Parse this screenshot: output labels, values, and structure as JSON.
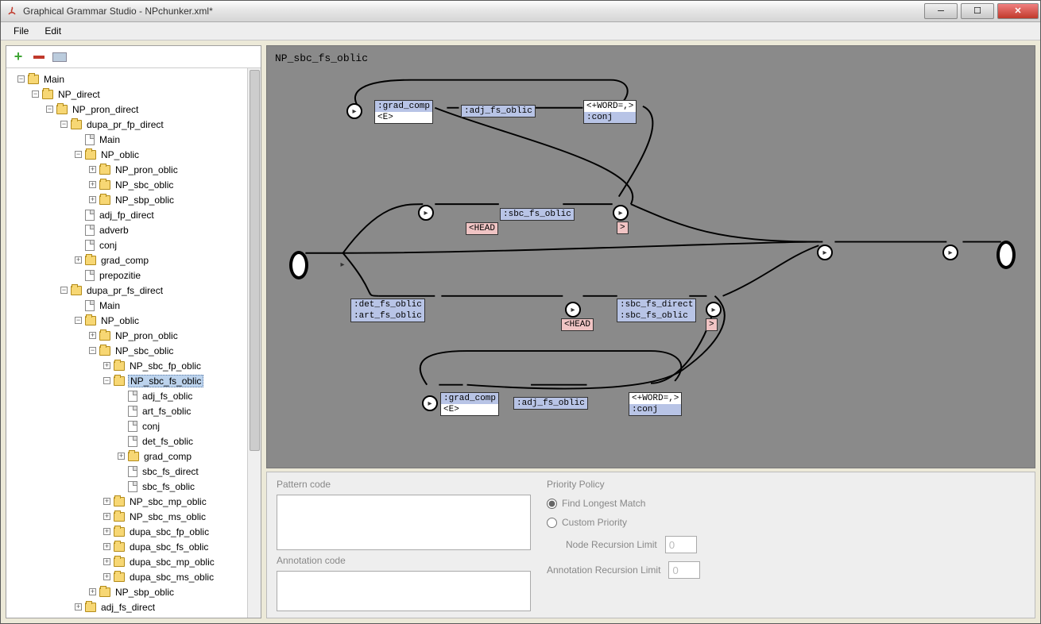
{
  "window": {
    "title": "Graphical Grammar Studio - NPchunker.xml*"
  },
  "menu": {
    "file": "File",
    "edit": "Edit"
  },
  "canvas": {
    "title": "NP_sbc_fs_oblic"
  },
  "tree": [
    {
      "d": 0,
      "t": "f",
      "x": "-",
      "l": "Main"
    },
    {
      "d": 1,
      "t": "f",
      "x": "-",
      "l": "NP_direct"
    },
    {
      "d": 2,
      "t": "f",
      "x": "-",
      "l": "NP_pron_direct"
    },
    {
      "d": 3,
      "t": "f",
      "x": "-",
      "l": "dupa_pr_fp_direct"
    },
    {
      "d": 4,
      "t": "p",
      "x": "",
      "l": "Main"
    },
    {
      "d": 4,
      "t": "f",
      "x": "-",
      "l": "NP_oblic"
    },
    {
      "d": 5,
      "t": "f",
      "x": "+",
      "l": "NP_pron_oblic"
    },
    {
      "d": 5,
      "t": "f",
      "x": "+",
      "l": "NP_sbc_oblic"
    },
    {
      "d": 5,
      "t": "f",
      "x": "+",
      "l": "NP_sbp_oblic"
    },
    {
      "d": 4,
      "t": "p",
      "x": "",
      "l": "adj_fp_direct"
    },
    {
      "d": 4,
      "t": "p",
      "x": "",
      "l": "adverb"
    },
    {
      "d": 4,
      "t": "p",
      "x": "",
      "l": "conj"
    },
    {
      "d": 4,
      "t": "f",
      "x": "+",
      "l": "grad_comp"
    },
    {
      "d": 4,
      "t": "p",
      "x": "",
      "l": "prepozitie"
    },
    {
      "d": 3,
      "t": "f",
      "x": "-",
      "l": "dupa_pr_fs_direct"
    },
    {
      "d": 4,
      "t": "p",
      "x": "",
      "l": "Main"
    },
    {
      "d": 4,
      "t": "f",
      "x": "-",
      "l": "NP_oblic"
    },
    {
      "d": 5,
      "t": "f",
      "x": "+",
      "l": "NP_pron_oblic"
    },
    {
      "d": 5,
      "t": "f",
      "x": "-",
      "l": "NP_sbc_oblic"
    },
    {
      "d": 6,
      "t": "f",
      "x": "+",
      "l": "NP_sbc_fp_oblic"
    },
    {
      "d": 6,
      "t": "f",
      "x": "-",
      "l": "NP_sbc_fs_oblic",
      "sel": true
    },
    {
      "d": 7,
      "t": "p",
      "x": "",
      "l": "adj_fs_oblic"
    },
    {
      "d": 7,
      "t": "p",
      "x": "",
      "l": "art_fs_oblic"
    },
    {
      "d": 7,
      "t": "p",
      "x": "",
      "l": "conj"
    },
    {
      "d": 7,
      "t": "p",
      "x": "",
      "l": "det_fs_oblic"
    },
    {
      "d": 7,
      "t": "f",
      "x": "+",
      "l": "grad_comp"
    },
    {
      "d": 7,
      "t": "p",
      "x": "",
      "l": "sbc_fs_direct"
    },
    {
      "d": 7,
      "t": "p",
      "x": "",
      "l": "sbc_fs_oblic"
    },
    {
      "d": 6,
      "t": "f",
      "x": "+",
      "l": "NP_sbc_mp_oblic"
    },
    {
      "d": 6,
      "t": "f",
      "x": "+",
      "l": "NP_sbc_ms_oblic"
    },
    {
      "d": 6,
      "t": "f",
      "x": "+",
      "l": "dupa_sbc_fp_oblic"
    },
    {
      "d": 6,
      "t": "f",
      "x": "+",
      "l": "dupa_sbc_fs_oblic"
    },
    {
      "d": 6,
      "t": "f",
      "x": "+",
      "l": "dupa_sbc_mp_oblic"
    },
    {
      "d": 6,
      "t": "f",
      "x": "+",
      "l": "dupa_sbc_ms_oblic"
    },
    {
      "d": 5,
      "t": "f",
      "x": "+",
      "l": "NP_sbp_oblic"
    },
    {
      "d": 4,
      "t": "f",
      "x": "+",
      "l": "adj_fs_direct"
    }
  ],
  "nodes": {
    "grad_comp_top": {
      "l1": ":grad_comp",
      "l2": "<E>"
    },
    "adj_top": ":adj_fs_oblic",
    "word_top": {
      "l1": "<+WORD=,>",
      "l2": ":conj"
    },
    "sbc_mid": ":sbc_fs_oblic",
    "head_mid": "<HEAD",
    "gt_mid": ">",
    "det_art": {
      "l1": ":det_fs_oblic",
      "l2": ":art_fs_oblic"
    },
    "head_low": "<HEAD",
    "sbc_direct": {
      "l1": ":sbc_fs_direct",
      "l2": ":sbc_fs_oblic"
    },
    "gt_low": ">",
    "grad_comp_bot": {
      "l1": ":grad_comp",
      "l2": "<E>"
    },
    "adj_bot": ":adj_fs_oblic",
    "word_bot": {
      "l1": "<+WORD=,>",
      "l2": ":conj"
    }
  },
  "bottom": {
    "pattern_label": "Pattern code",
    "annotation_label": "Annotation code",
    "priority_label": "Priority Policy",
    "longest": "Find Longest Match",
    "custom": "Custom Priority",
    "node_limit": "Node Recursion Limit",
    "anno_limit": "Annotation Recursion Limit",
    "limit_val": "0"
  }
}
